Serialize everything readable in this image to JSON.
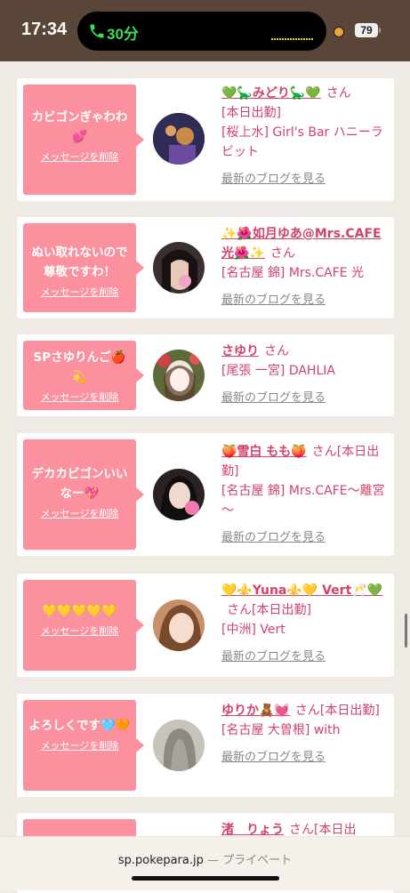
{
  "status": {
    "time": "17:34",
    "call_duration": "30分",
    "battery": "79"
  },
  "cards": [
    {
      "message": "カビゴンぎゃわわ💕",
      "delete": "メッセージを削除",
      "name": "💚🦕みどり🦕💚",
      "san": "さん",
      "lines": [
        "[本日出勤]",
        "[桜上水] Girl's Bar ハニーラビット"
      ],
      "blog": "最新のブログを見る",
      "avatar_color": "#2f2c55"
    },
    {
      "message": "ぬい取れないので尊敬ですわ！",
      "delete": "メッセージを削除",
      "name": "✨🌺如月ゆあ@Mrs.CAFE光🌺✨",
      "san": "さん",
      "lines": [
        "[名古屋 錦] Mrs.CAFE 光"
      ],
      "blog": "最新のブログを見る",
      "avatar_color": "#3a3030"
    },
    {
      "message": "SPさゆりんご🍎💫",
      "delete": "メッセージを削除",
      "name": "さゆり",
      "san": "さん",
      "lines": [
        "[尾張 一宮] DAHLIA"
      ],
      "blog": "最新のブログを見る",
      "avatar_color": "#6b5a3a"
    },
    {
      "message": "デカカビゴンいいなー💖",
      "delete": "メッセージを削除",
      "name": "🍑雪白 もも🍑",
      "san": "さん[本日出勤]",
      "lines": [
        "[名古屋 錦] Mrs.CAFE～離宮～"
      ],
      "blog": "最新のブログを見る",
      "avatar_color": "#2a2222"
    },
    {
      "message": "💛💛💛💛💛",
      "delete": "メッセージを削除",
      "name": "💛⚜️Yuna⚜️💛 Vert🥂💚",
      "san": "さん[本日出勤]",
      "lines": [
        "[中洲] Vert"
      ],
      "blog": "最新のブログを見る",
      "avatar_color": "#c98f6a"
    },
    {
      "message": "よろしくです🩵🧡",
      "delete": "メッセージを削除",
      "name": "ゆりか🧸💓",
      "san": "さん[本日出勤]",
      "lines": [
        "[名古屋 大曽根] with"
      ],
      "blog": "最新のブログを見る",
      "avatar_color": "#9a968e"
    },
    {
      "message": "",
      "delete": "",
      "name": "渚　りょう",
      "san": "さん[本日出",
      "lines": [],
      "blog": "",
      "avatar_color": "#ffffff"
    }
  ],
  "browser": {
    "url": "sp.pokepara.jp",
    "mode": " — プライベート"
  }
}
